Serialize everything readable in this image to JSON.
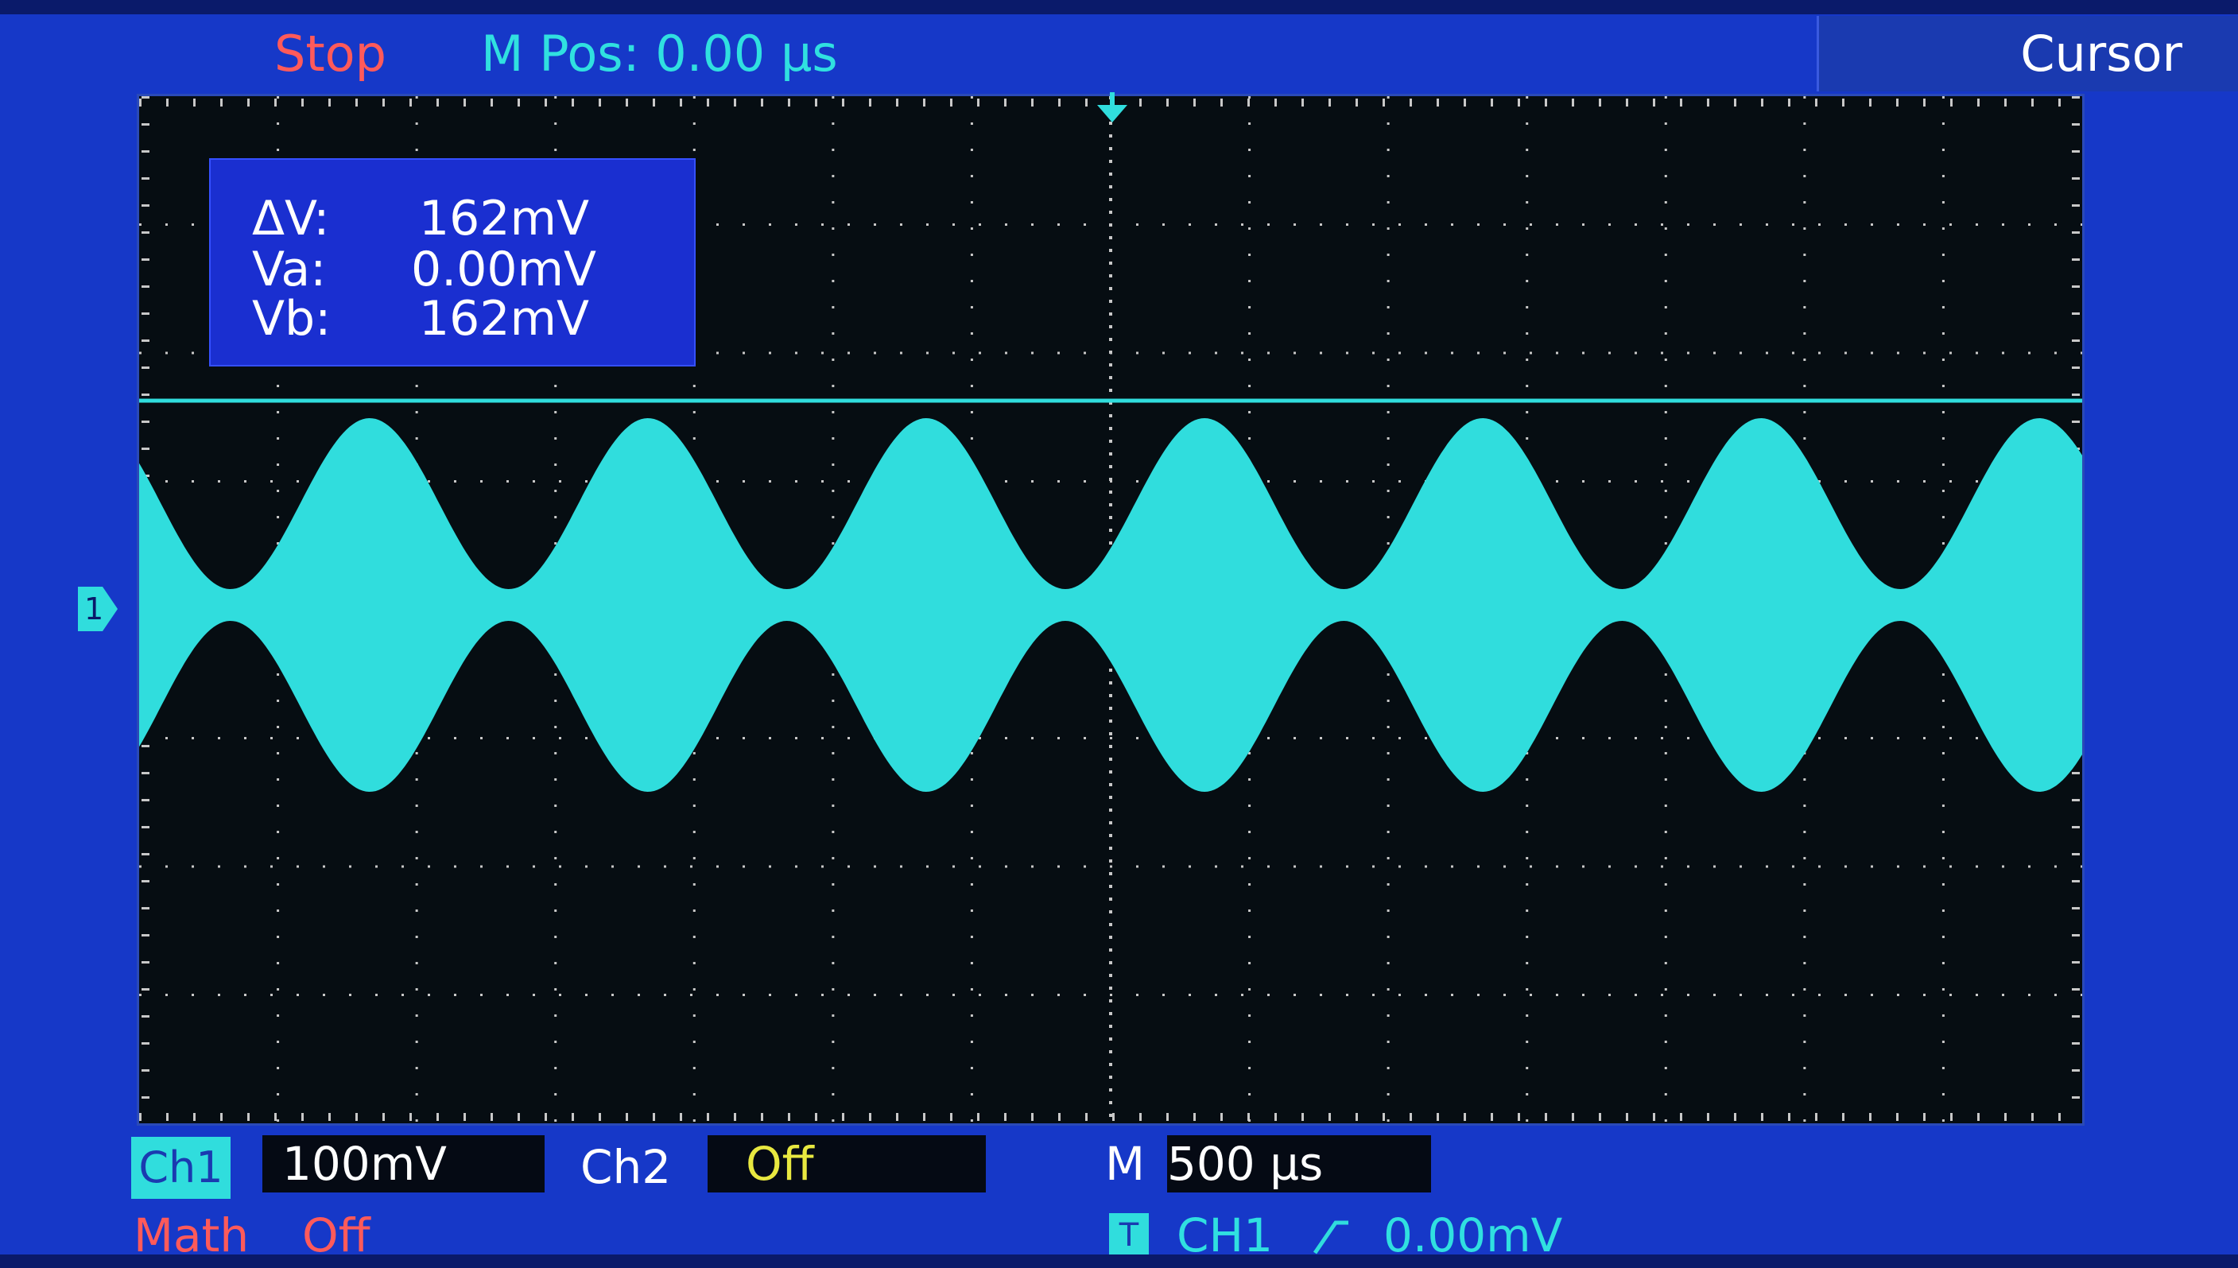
{
  "status": {
    "run_state": "Stop",
    "m_pos": "M Pos: 0.00 µs"
  },
  "menu": {
    "active": "Cursor"
  },
  "cursor_readout": {
    "rows": [
      {
        "label": "ΔV:",
        "value": "162mV"
      },
      {
        "label": "Va:",
        "value": "0.00mV"
      },
      {
        "label": "Vb:",
        "value": "162mV"
      }
    ]
  },
  "channel_marker": "1",
  "bottom": {
    "ch1_label": "Ch1",
    "ch1_scale": "100mV",
    "ch2_label": "Ch2",
    "ch2_value": "Off",
    "time_prefix": "M",
    "time_scale": "500 µs",
    "math_label": "Math",
    "math_value": "Off",
    "trigger_icon": "T",
    "trigger_source": "CH1",
    "trigger_level": "0.00mV"
  },
  "colors": {
    "trace": "#30dddd",
    "background": "#1638c8",
    "stop": "#ff5a5a",
    "ch2_off": "#e8e840"
  },
  "waveform": {
    "type": "amplitude-modulated sine",
    "envelope_peaks": 7,
    "cursor_vb": "162mV"
  }
}
